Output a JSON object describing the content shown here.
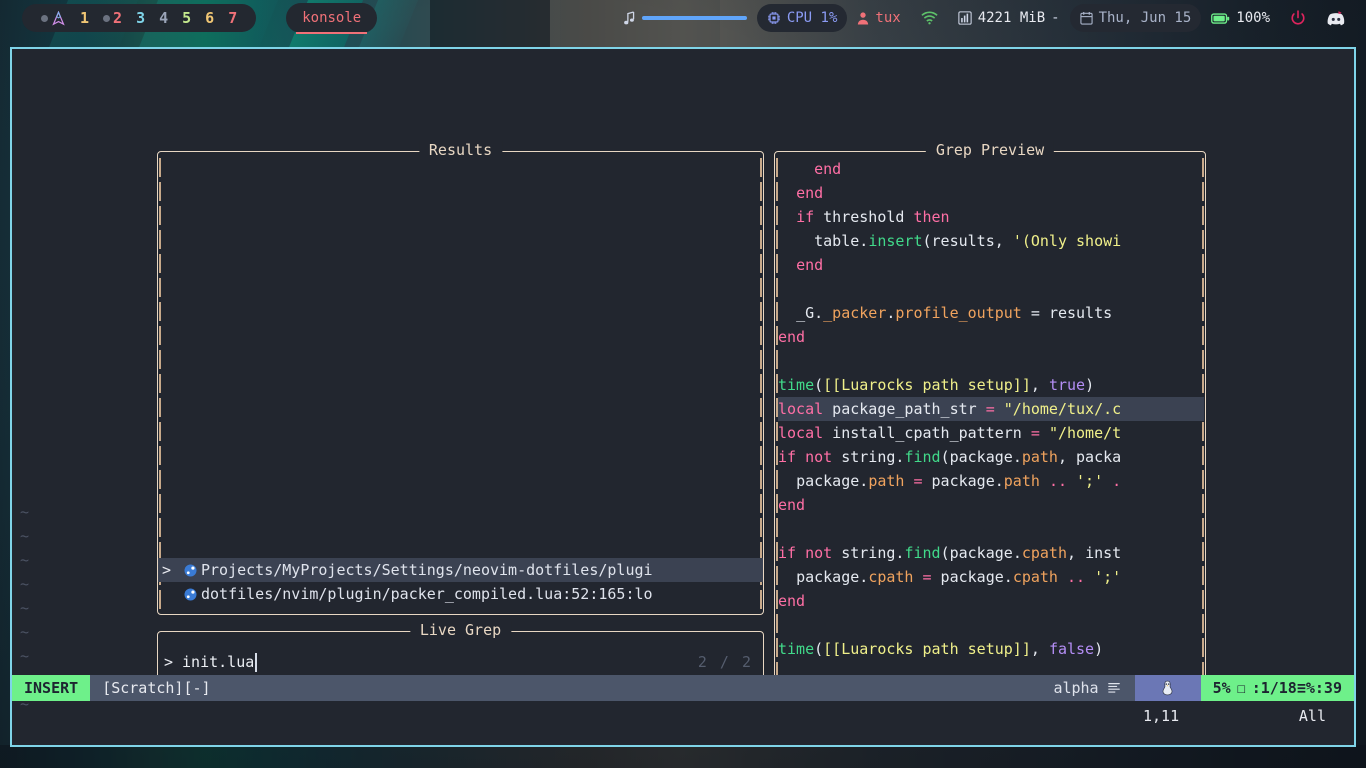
{
  "taskbar": {
    "arch_icon": "arch-logo-icon",
    "workspaces": [
      {
        "label": "1",
        "color": "#f0c674",
        "dot": false
      },
      {
        "label": "2",
        "color": "#f07178",
        "dot": true
      },
      {
        "label": "3",
        "color": "#7fd4e8",
        "dot": false
      },
      {
        "label": "4",
        "color": "#9aa4b8",
        "dot": false
      },
      {
        "label": "5",
        "color": "#c3e88d",
        "dot": false
      },
      {
        "label": "6",
        "color": "#f0c674",
        "dot": false
      },
      {
        "label": "7",
        "color": "#f07178",
        "dot": false
      }
    ],
    "window_title": "konsole",
    "music_icon": "music-note-icon",
    "volume_percent": 100,
    "cpu_icon": "cpu-chip-icon",
    "cpu_label": "CPU 1%",
    "user_icon": "user-icon",
    "user_label": "tux",
    "wifi_icon": "wifi-icon",
    "memory_icon": "memory-bars-icon",
    "memory_label": "4221 MiB",
    "memory_suffix": "-",
    "calendar_icon": "calendar-icon",
    "date_label": "Thu, Jun 15",
    "battery_icon": "battery-icon",
    "battery_label": "100%",
    "power_icon": "power-icon",
    "discord_icon": "discord-icon"
  },
  "editor": {
    "tilde_count": 9,
    "tilde_char": "~"
  },
  "telescope": {
    "results": {
      "title": "Results",
      "rows": [
        {
          "caret": ">",
          "icon": "lua-file-icon",
          "text": "Projects/MyProjects/Settings/neovim-dotfiles/plugi",
          "selected": true
        },
        {
          "caret": "",
          "icon": "lua-file-icon",
          "text": "dotfiles/nvim/plugin/packer_compiled.lua:52:165:lo",
          "selected": false
        }
      ]
    },
    "prompt": {
      "title": "Live Grep",
      "caret": ">",
      "value": "init.lua",
      "counter": "2 / 2"
    },
    "preview": {
      "title": "Grep Preview",
      "lines": [
        {
          "hl": false,
          "tokens": [
            {
              "t": "    ",
              "c": "op"
            },
            {
              "t": "end",
              "c": "k"
            }
          ]
        },
        {
          "hl": false,
          "tokens": [
            {
              "t": "  ",
              "c": "op"
            },
            {
              "t": "end",
              "c": "k"
            }
          ]
        },
        {
          "hl": false,
          "tokens": [
            {
              "t": "  ",
              "c": "op"
            },
            {
              "t": "if",
              "c": "k"
            },
            {
              "t": " threshold ",
              "c": "id"
            },
            {
              "t": "then",
              "c": "k"
            }
          ]
        },
        {
          "hl": false,
          "tokens": [
            {
              "t": "    ",
              "c": "op"
            },
            {
              "t": "table",
              "c": "id"
            },
            {
              "t": ".",
              "c": "op"
            },
            {
              "t": "insert",
              "c": "fn"
            },
            {
              "t": "(",
              "c": "op"
            },
            {
              "t": "results",
              "c": "id"
            },
            {
              "t": ", ",
              "c": "op"
            },
            {
              "t": "'(Only showi",
              "c": "st"
            }
          ]
        },
        {
          "hl": false,
          "tokens": [
            {
              "t": "  ",
              "c": "op"
            },
            {
              "t": "end",
              "c": "k"
            }
          ]
        },
        {
          "hl": false,
          "tokens": []
        },
        {
          "hl": false,
          "tokens": [
            {
              "t": "  ",
              "c": "op"
            },
            {
              "t": "_G",
              "c": "id"
            },
            {
              "t": ".",
              "c": "op"
            },
            {
              "t": "_packer",
              "c": "pr"
            },
            {
              "t": ".",
              "c": "op"
            },
            {
              "t": "profile_output",
              "c": "pr"
            },
            {
              "t": " = ",
              "c": "op"
            },
            {
              "t": "results",
              "c": "id"
            }
          ]
        },
        {
          "hl": false,
          "tokens": [
            {
              "t": "end",
              "c": "k"
            }
          ]
        },
        {
          "hl": false,
          "tokens": []
        },
        {
          "hl": false,
          "tokens": [
            {
              "t": "time",
              "c": "fn"
            },
            {
              "t": "(",
              "c": "op"
            },
            {
              "t": "[[Luarocks path setup]]",
              "c": "st"
            },
            {
              "t": ", ",
              "c": "op"
            },
            {
              "t": "true",
              "c": "bo"
            },
            {
              "t": ")",
              "c": "op"
            }
          ]
        },
        {
          "hl": true,
          "tokens": [
            {
              "t": "local",
              "c": "k"
            },
            {
              "t": " package_path_str ",
              "c": "id"
            },
            {
              "t": "=",
              "c": "eq"
            },
            {
              "t": " ",
              "c": "op"
            },
            {
              "t": "\"/home/tux/.c",
              "c": "st"
            }
          ]
        },
        {
          "hl": false,
          "tokens": [
            {
              "t": "local",
              "c": "k"
            },
            {
              "t": " install_cpath_pattern ",
              "c": "id"
            },
            {
              "t": "=",
              "c": "eq"
            },
            {
              "t": " ",
              "c": "op"
            },
            {
              "t": "\"/home/t",
              "c": "st"
            }
          ]
        },
        {
          "hl": false,
          "tokens": [
            {
              "t": "if",
              "c": "k"
            },
            {
              "t": " ",
              "c": "op"
            },
            {
              "t": "not",
              "c": "k"
            },
            {
              "t": " string",
              "c": "id"
            },
            {
              "t": ".",
              "c": "op"
            },
            {
              "t": "find",
              "c": "fn"
            },
            {
              "t": "(",
              "c": "op"
            },
            {
              "t": "package",
              "c": "id"
            },
            {
              "t": ".",
              "c": "op"
            },
            {
              "t": "path",
              "c": "pr"
            },
            {
              "t": ", ",
              "c": "op"
            },
            {
              "t": "packa",
              "c": "id"
            }
          ]
        },
        {
          "hl": false,
          "tokens": [
            {
              "t": "  ",
              "c": "op"
            },
            {
              "t": "package",
              "c": "id"
            },
            {
              "t": ".",
              "c": "op"
            },
            {
              "t": "path",
              "c": "pr"
            },
            {
              "t": " ",
              "c": "op"
            },
            {
              "t": "=",
              "c": "eq"
            },
            {
              "t": " package",
              "c": "id"
            },
            {
              "t": ".",
              "c": "op"
            },
            {
              "t": "path",
              "c": "pr"
            },
            {
              "t": " ",
              "c": "op"
            },
            {
              "t": "..",
              "c": "eq"
            },
            {
              "t": " ",
              "c": "op"
            },
            {
              "t": "';'",
              "c": "st"
            },
            {
              "t": " ",
              "c": "op"
            },
            {
              "t": ".",
              "c": "eq"
            }
          ]
        },
        {
          "hl": false,
          "tokens": [
            {
              "t": "end",
              "c": "k"
            }
          ]
        },
        {
          "hl": false,
          "tokens": []
        },
        {
          "hl": false,
          "tokens": [
            {
              "t": "if",
              "c": "k"
            },
            {
              "t": " ",
              "c": "op"
            },
            {
              "t": "not",
              "c": "k"
            },
            {
              "t": " string",
              "c": "id"
            },
            {
              "t": ".",
              "c": "op"
            },
            {
              "t": "find",
              "c": "fn"
            },
            {
              "t": "(",
              "c": "op"
            },
            {
              "t": "package",
              "c": "id"
            },
            {
              "t": ".",
              "c": "op"
            },
            {
              "t": "cpath",
              "c": "pr"
            },
            {
              "t": ", ",
              "c": "op"
            },
            {
              "t": "inst",
              "c": "id"
            }
          ]
        },
        {
          "hl": false,
          "tokens": [
            {
              "t": "  ",
              "c": "op"
            },
            {
              "t": "package",
              "c": "id"
            },
            {
              "t": ".",
              "c": "op"
            },
            {
              "t": "cpath",
              "c": "pr"
            },
            {
              "t": " ",
              "c": "op"
            },
            {
              "t": "=",
              "c": "eq"
            },
            {
              "t": " package",
              "c": "id"
            },
            {
              "t": ".",
              "c": "op"
            },
            {
              "t": "cpath",
              "c": "pr"
            },
            {
              "t": " ",
              "c": "op"
            },
            {
              "t": "..",
              "c": "eq"
            },
            {
              "t": " ",
              "c": "op"
            },
            {
              "t": "';'",
              "c": "st"
            }
          ]
        },
        {
          "hl": false,
          "tokens": [
            {
              "t": "end",
              "c": "k"
            }
          ]
        },
        {
          "hl": false,
          "tokens": []
        },
        {
          "hl": false,
          "tokens": [
            {
              "t": "time",
              "c": "fn"
            },
            {
              "t": "(",
              "c": "op"
            },
            {
              "t": "[[Luarocks path setup]]",
              "c": "st"
            },
            {
              "t": ", ",
              "c": "op"
            },
            {
              "t": "false",
              "c": "bo"
            },
            {
              "t": ")",
              "c": "op"
            }
          ]
        }
      ]
    }
  },
  "statusline": {
    "mode": "INSERT",
    "filename": "[Scratch][-]",
    "filetype": "alpha",
    "filetype_icon": "lines-icon",
    "os_icon": "linux-penguin-icon",
    "scroll_percent": "5%",
    "lock_glyph": "☐",
    "position": ":1/18≡%:39",
    "ruler": "1,11",
    "view": "All"
  },
  "colors": {
    "accent_border": "#7fd4e8",
    "telescope_border": "#e8d7c3",
    "mode_green": "#6ef08a",
    "selection": "#3b4252",
    "background": "#22262f"
  }
}
